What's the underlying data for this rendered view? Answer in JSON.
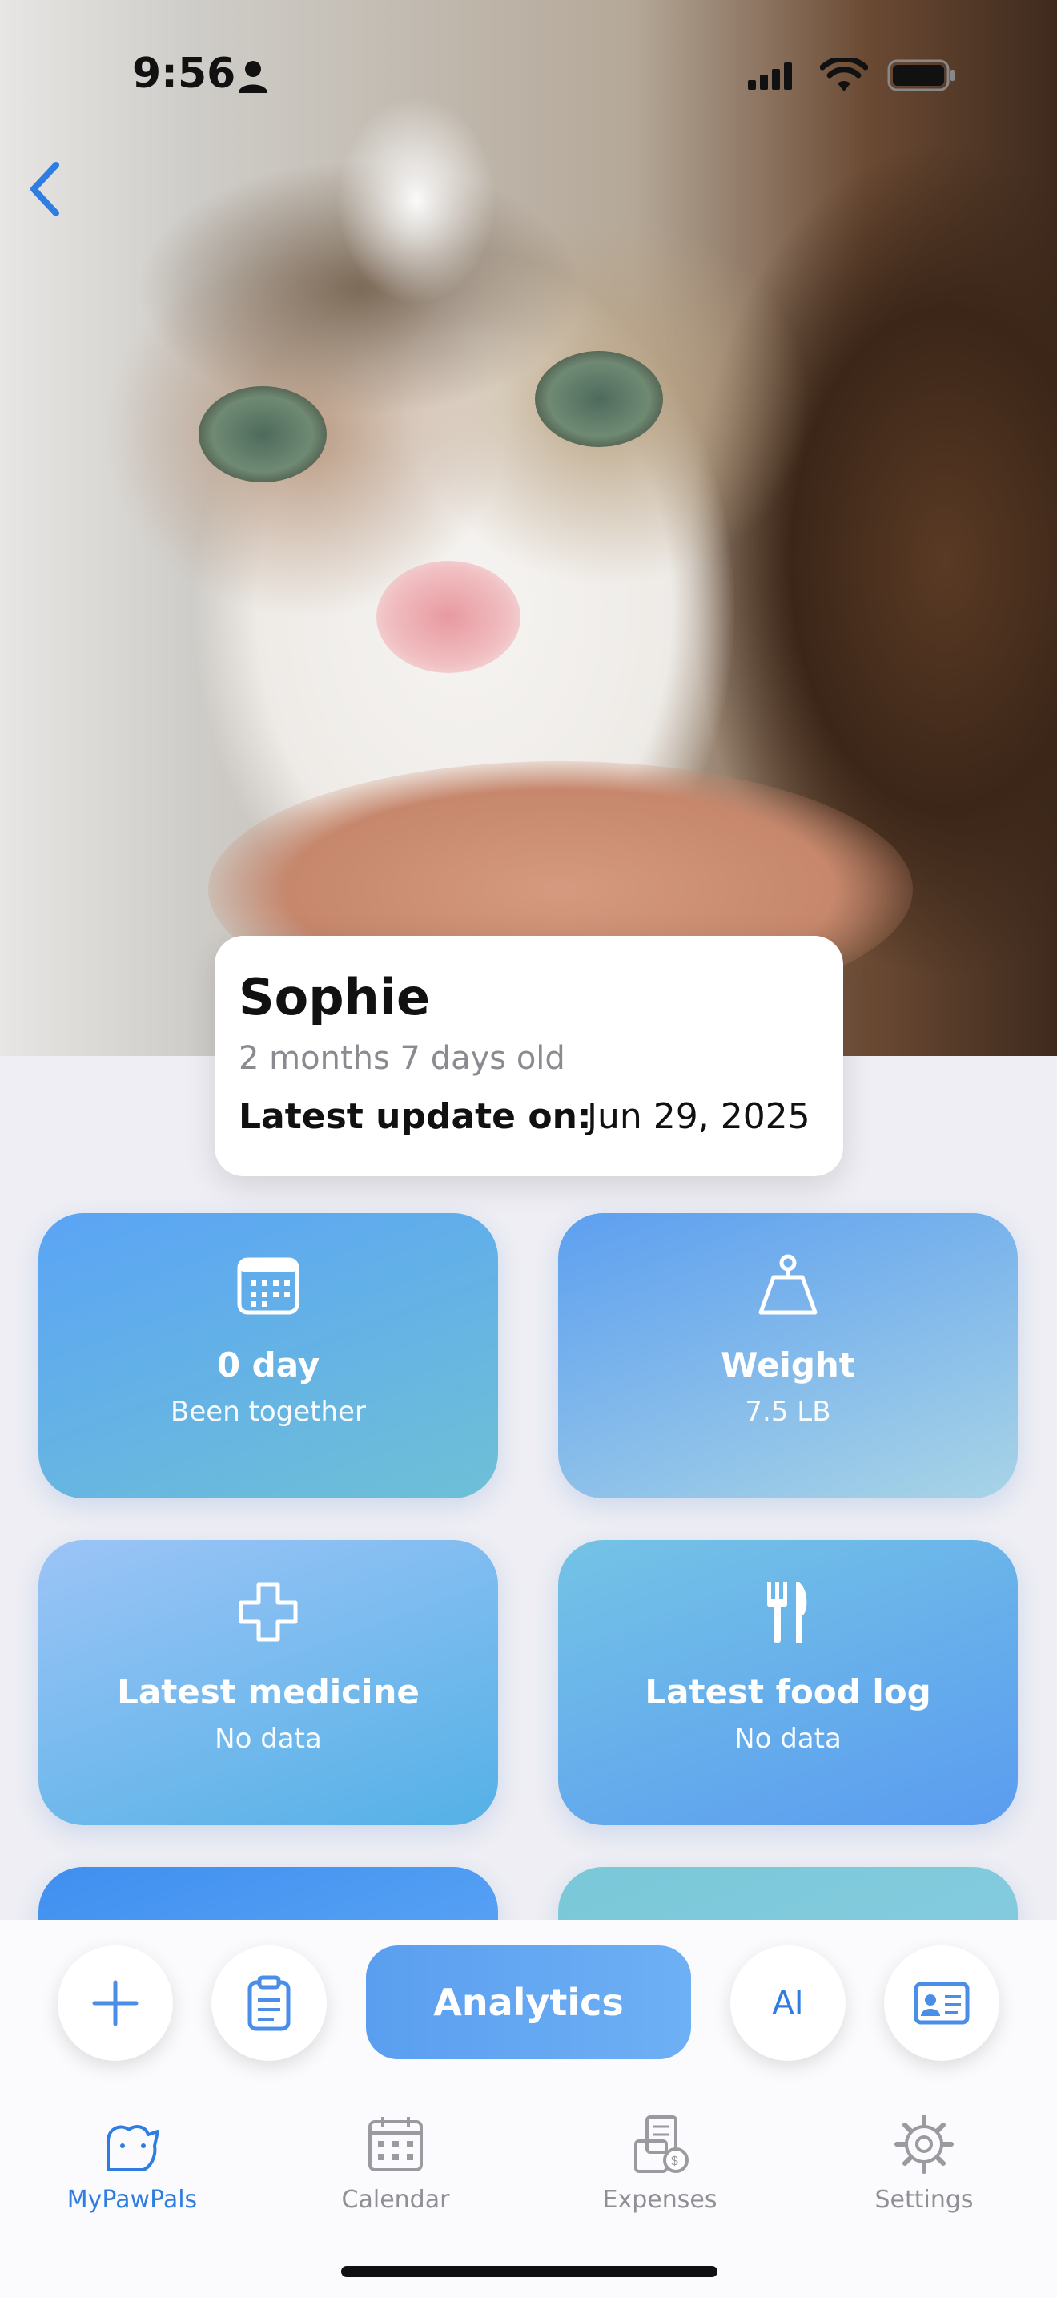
{
  "status_bar": {
    "time": "9:56"
  },
  "pet": {
    "name": "Sophie",
    "age": "2 months 7 days old",
    "latest_update_label": "Latest update on:",
    "latest_update_date": "Jun 29, 2025"
  },
  "tiles": [
    {
      "icon": "calendar-icon",
      "title": "0 day",
      "subtitle": "Been together"
    },
    {
      "icon": "weight-icon",
      "title": "Weight",
      "subtitle": "7.5 LB"
    },
    {
      "icon": "medicine-cross-icon",
      "title": "Latest medicine",
      "subtitle": "No data"
    },
    {
      "icon": "fork-knife-icon",
      "title": "Latest food log",
      "subtitle": "No data"
    }
  ],
  "actions": {
    "add_icon": "plus-icon",
    "notes_icon": "clipboard-icon",
    "analytics_label": "Analytics",
    "ai_label": "AI",
    "profile_icon": "id-card-icon"
  },
  "tabbar": {
    "items": [
      {
        "label": "MyPawPals",
        "icon": "pets-icon",
        "active": true
      },
      {
        "label": "Calendar",
        "icon": "calendar-icon",
        "active": false
      },
      {
        "label": "Expenses",
        "icon": "expenses-icon",
        "active": false
      },
      {
        "label": "Settings",
        "icon": "gear-icon",
        "active": false
      }
    ]
  },
  "colors": {
    "accent": "#2f7de1",
    "tile_blue": "#5aa4f5"
  }
}
